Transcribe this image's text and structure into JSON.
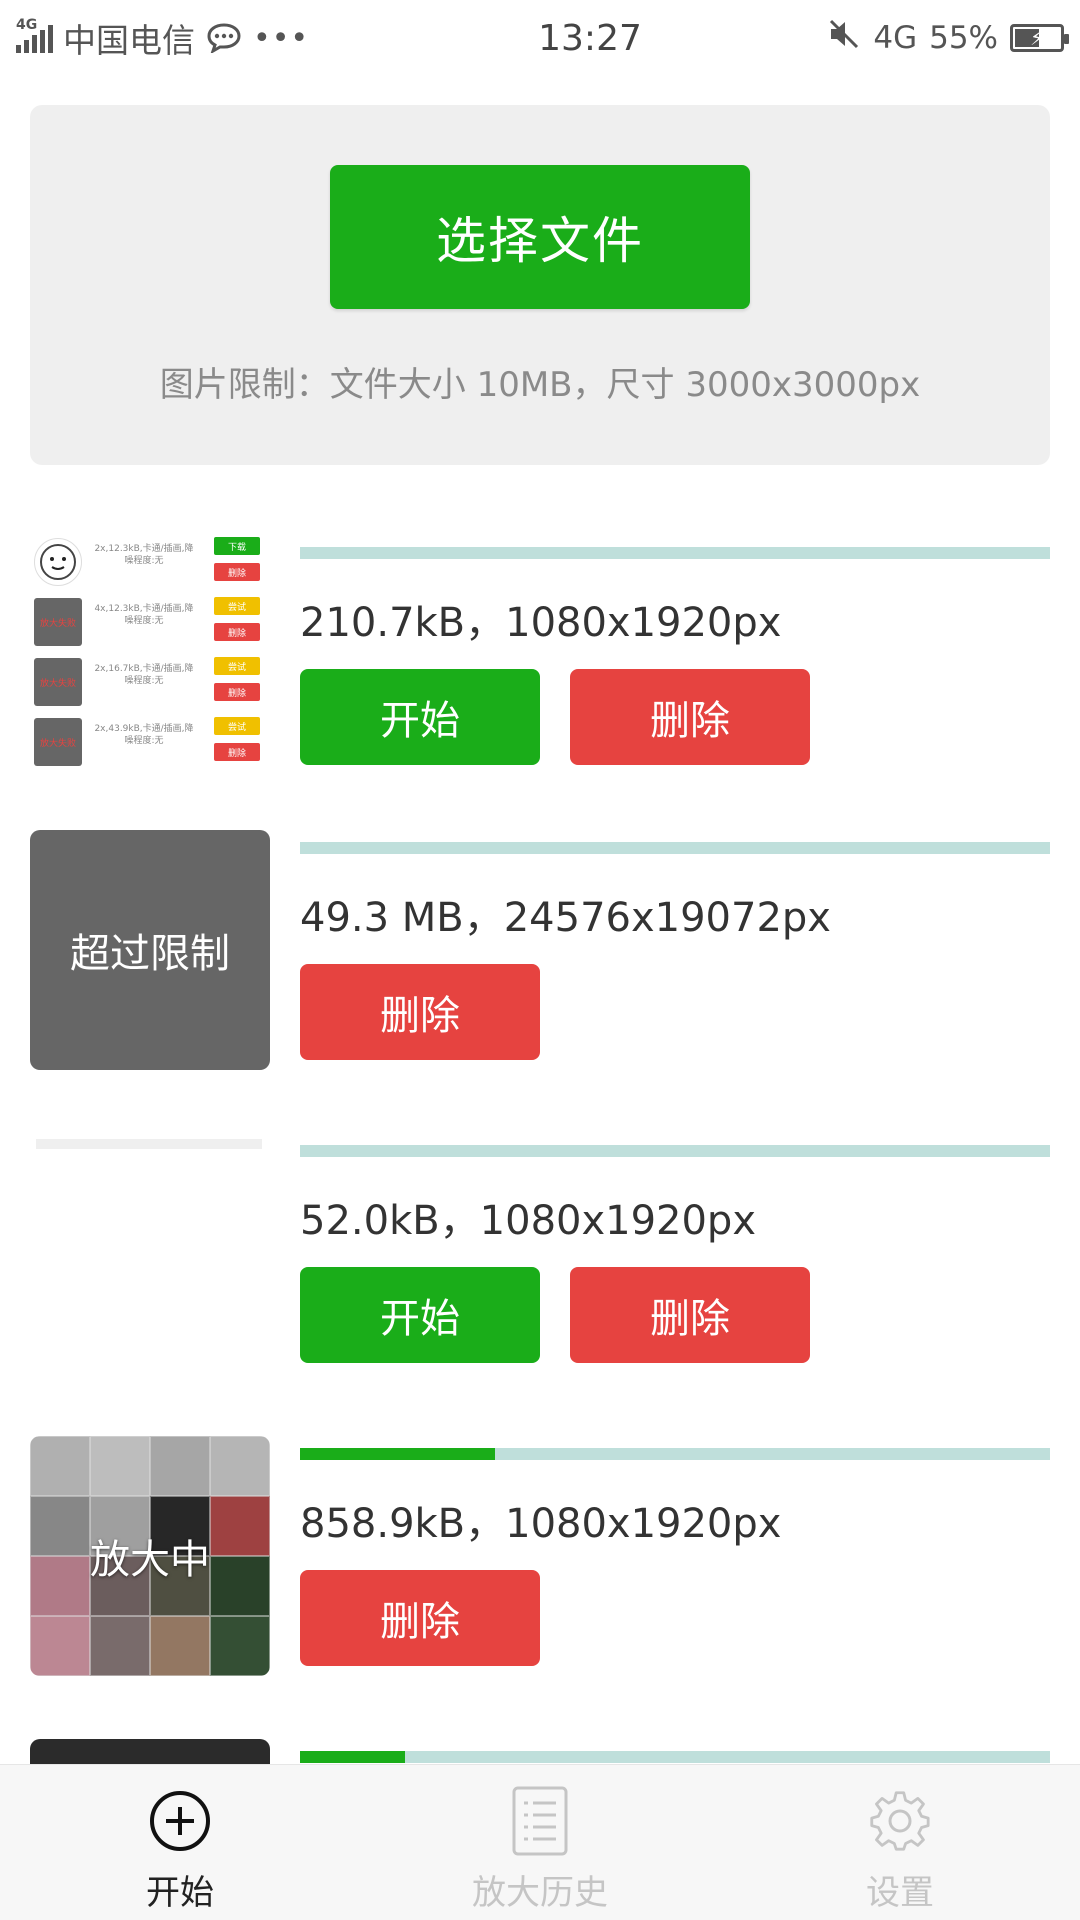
{
  "status_bar": {
    "network_type": "4G",
    "carrier": "中国电信",
    "more": "•••",
    "time": "13:27",
    "mobile_data": "4G",
    "battery_percent": "55%",
    "battery_level": 0.55
  },
  "upload": {
    "select_button": "选择文件",
    "hint": "图片限制：文件大小 10MB，尺寸 3000x3000px"
  },
  "files": [
    {
      "info": "210.7kB，1080x1920px",
      "progress": 0,
      "start_label": "开始",
      "delete_label": "删除",
      "thumbnail_rows": [
        {
          "text": "2x,12.3kB,卡通/插画,降噪程度:无",
          "btn1": "下载",
          "btn2": "删除",
          "btn1_color": "#1aad19"
        },
        {
          "text": "4x,12.3kB,卡通/插画,降噪程度:无",
          "btn1": "尝试",
          "btn2": "删除",
          "btn1_color": "#f0c000",
          "img_text": "放大失败"
        },
        {
          "text": "2x,16.7kB,卡通/插画,降噪程度:无",
          "btn1": "尝试",
          "btn2": "删除",
          "btn1_color": "#f0c000",
          "img_text": "放大失败"
        },
        {
          "text": "2x,43.9kB,卡通/插画,降噪程度:无",
          "btn1": "尝试",
          "btn2": "删除",
          "btn1_color": "#f0c000",
          "img_text": "放大失败"
        }
      ]
    },
    {
      "info": "49.3 MB，24576x19072px",
      "progress": 0,
      "thumb_label": "超过限制",
      "delete_label": "删除"
    },
    {
      "info": "52.0kB，1080x1920px",
      "progress": 0,
      "start_label": "开始",
      "delete_label": "删除"
    },
    {
      "info": "858.9kB，1080x1920px",
      "progress": 0.26,
      "thumb_label": "放大中",
      "delete_label": "删除"
    },
    {
      "progress": 0.14
    }
  ],
  "tabs": [
    {
      "label": "开始",
      "icon": "plus-circle-icon",
      "active": true
    },
    {
      "label": "放大历史",
      "icon": "list-icon",
      "active": false
    },
    {
      "label": "设置",
      "icon": "gear-icon",
      "active": false
    }
  ],
  "colors": {
    "primary_green": "#1aad19",
    "danger_red": "#e64340",
    "progress_track": "#bfdfdb",
    "panel_gray": "#efefef"
  }
}
